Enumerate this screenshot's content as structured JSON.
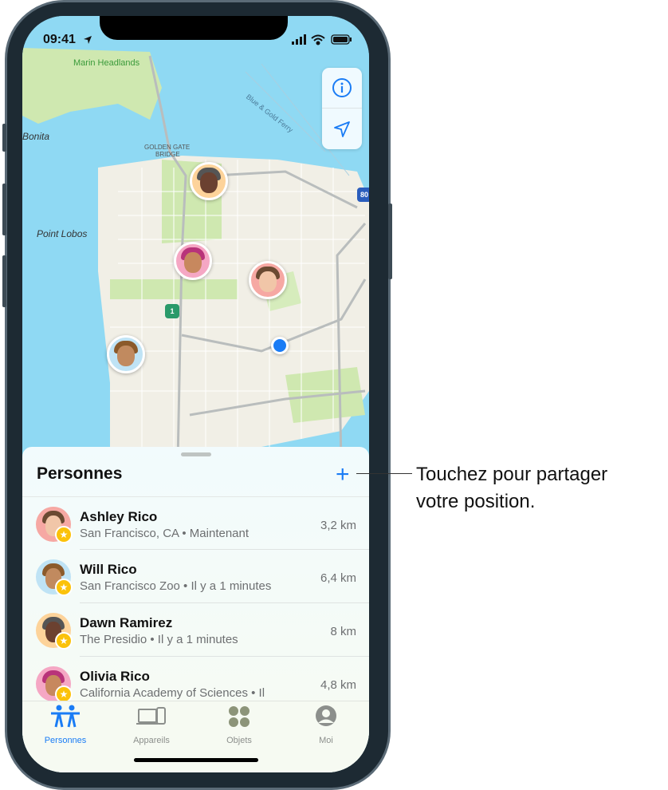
{
  "status_bar": {
    "time": "09:41"
  },
  "map": {
    "labels": [
      "Marin Headlands",
      "Bonita",
      "GOLDEN GATE",
      "BRIDGE",
      "Blue & Gold Ferry",
      "Point Lobos",
      "80",
      "1",
      "Ferry"
    ],
    "controls": {
      "info_icon": "info-icon",
      "location_icon": "location-arrow-icon"
    },
    "colors": {
      "water": "#8fd9f3",
      "land": "#f1efe6",
      "park": "#c9e7a8",
      "accent": "#1a7cf5"
    }
  },
  "sheet": {
    "title": "Personnes",
    "add_label": "+",
    "people": [
      {
        "name": "Ashley Rico",
        "detail": "San Francisco, CA • Maintenant",
        "distance": "3,2 km"
      },
      {
        "name": "Will Rico",
        "detail": "San Francisco Zoo • Il y a 1 minutes",
        "distance": "6,4 km"
      },
      {
        "name": "Dawn Ramirez",
        "detail": "The Presidio • Il y a 1 minutes",
        "distance": "8 km"
      },
      {
        "name": "Olivia Rico",
        "detail": "California Academy of Sciences • Il",
        "distance": "4,8 km"
      }
    ]
  },
  "tabs": [
    {
      "label": "Personnes",
      "active": true
    },
    {
      "label": "Appareils"
    },
    {
      "label": "Objets"
    },
    {
      "label": "Moi"
    }
  ],
  "callout": {
    "line1": "Touchez pour partager",
    "line2": "votre position."
  }
}
